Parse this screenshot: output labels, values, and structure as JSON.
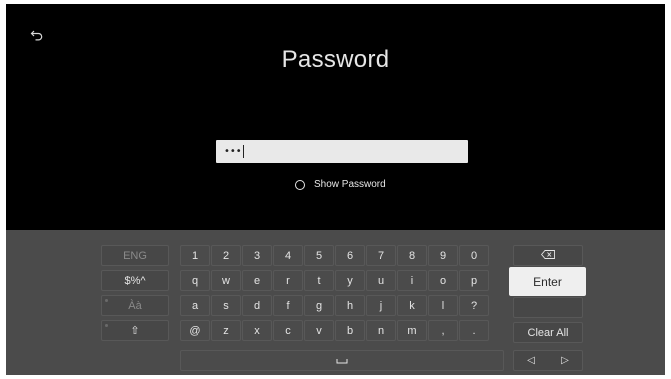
{
  "header": {
    "title": "Password"
  },
  "password": {
    "value": "•••"
  },
  "show_password": {
    "label": "Show Password"
  },
  "keyboard": {
    "row1": [
      "1",
      "2",
      "3",
      "4",
      "5",
      "6",
      "7",
      "8",
      "9",
      "0"
    ],
    "row2": [
      "q",
      "w",
      "e",
      "r",
      "t",
      "y",
      "u",
      "i",
      "o",
      "p"
    ],
    "row3": [
      "a",
      "s",
      "d",
      "f",
      "g",
      "h",
      "j",
      "k",
      "l",
      "?"
    ],
    "row4": [
      "@",
      "z",
      "x",
      "c",
      "v",
      "b",
      "n",
      "m",
      ",",
      "."
    ],
    "left": {
      "lang": "ENG",
      "symbols": "$%^",
      "accents": "Àà",
      "shift": "⇧"
    },
    "right": {
      "enter": "Enter",
      "clear_all": "Clear All"
    },
    "space_glyph": "␣",
    "arrow_left": "◁",
    "arrow_right": "▷"
  },
  "icons": {
    "back": "back-arrow-icon",
    "backspace": "backspace-icon"
  }
}
